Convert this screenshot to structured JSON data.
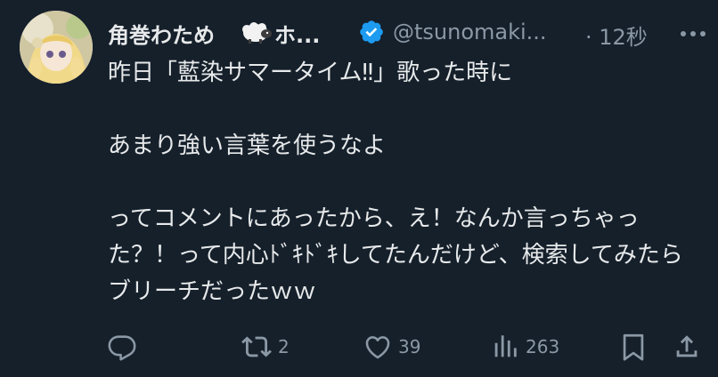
{
  "author": {
    "display_name": "角巻わため",
    "name_suffix": "ホ...",
    "handle": "@tsunomaki...",
    "time": "· 12秒"
  },
  "tweet": {
    "text": "昨日「藍染サマータイム‼」歌った時に\n\nあまり強い言葉を使うなよ\n\nってコメントにあったから、え！なんか言っちゃった？！って内心ﾄﾞｷﾄﾞｷしてたんだけど、検索してみたらブリーチだったｗｗ"
  },
  "actions": {
    "reply_count": "",
    "retweet_count": "2",
    "like_count": "39",
    "views_count": "263"
  },
  "icons": {
    "verified": "verified-badge-icon",
    "more": "more-icon",
    "reply": "reply-icon",
    "retweet": "retweet-icon",
    "like": "like-icon",
    "views": "views-icon",
    "bookmark": "bookmark-icon",
    "share": "share-icon"
  },
  "colors": {
    "background": "#15202b",
    "text": "#e7e9ea",
    "muted": "#8b98a5",
    "verified": "#1d9bf0"
  }
}
